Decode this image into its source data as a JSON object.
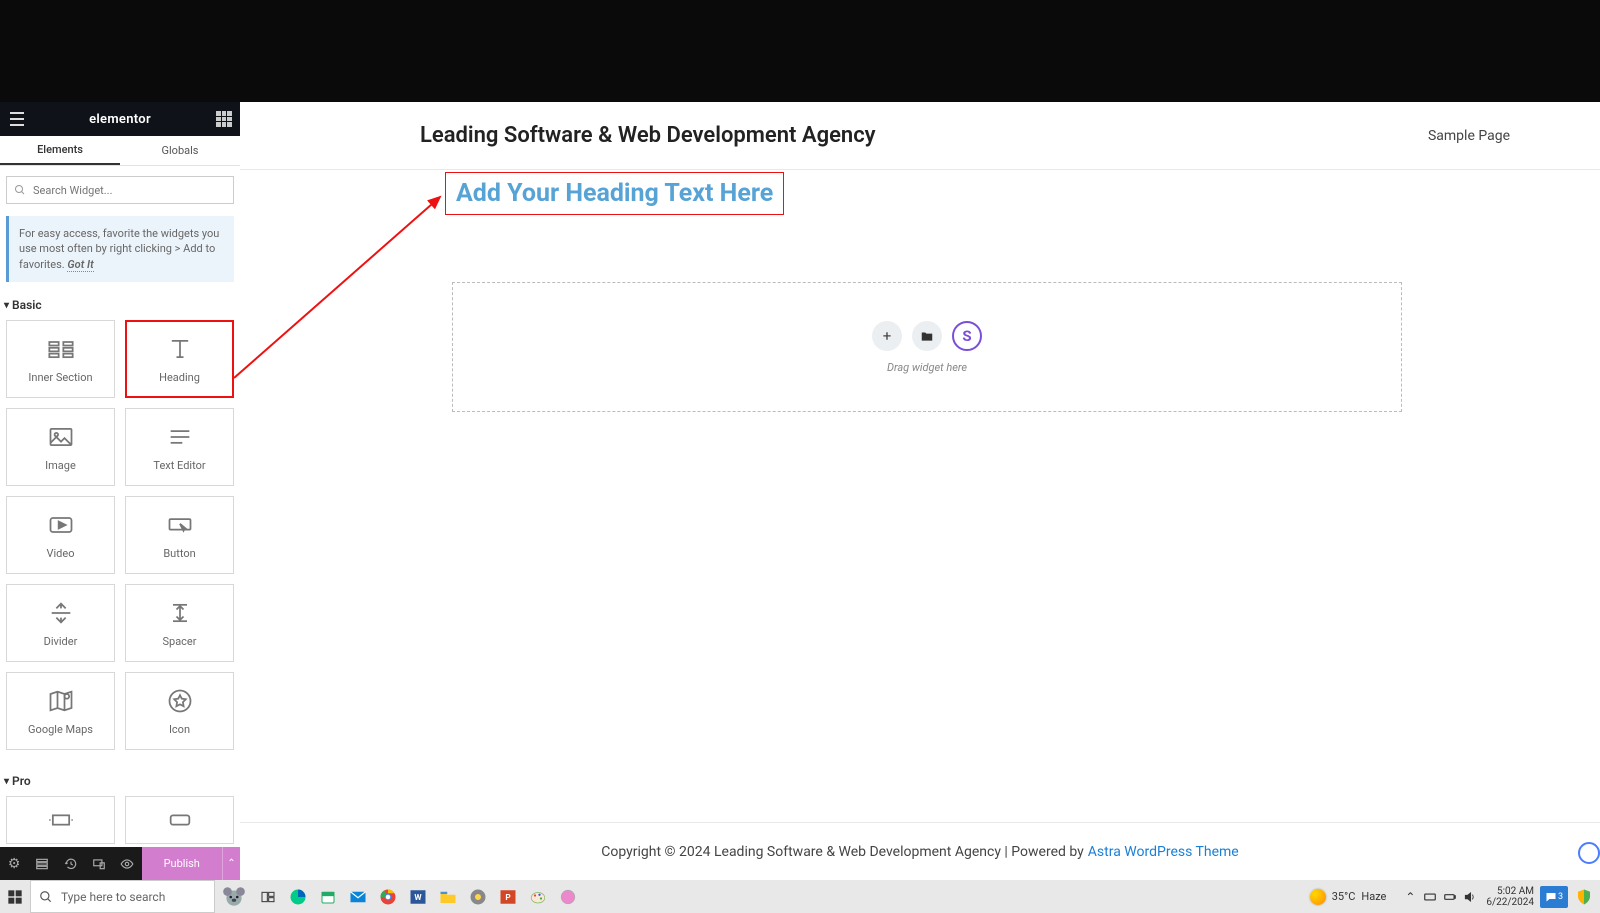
{
  "sidebar": {
    "title": "elementor",
    "tabs": {
      "elements": "Elements",
      "globals": "Globals"
    },
    "search_placeholder": "Search Widget...",
    "tip_text": "For easy access, favorite the widgets you use most often by right clicking > Add to favorites.",
    "tip_gotit": "Got It",
    "categories": {
      "basic": {
        "label": "Basic",
        "widgets": [
          {
            "id": "inner-section",
            "label": "Inner Section"
          },
          {
            "id": "heading",
            "label": "Heading",
            "highlighted": true
          },
          {
            "id": "image",
            "label": "Image"
          },
          {
            "id": "text-editor",
            "label": "Text Editor"
          },
          {
            "id": "video",
            "label": "Video"
          },
          {
            "id": "button",
            "label": "Button"
          },
          {
            "id": "divider",
            "label": "Divider"
          },
          {
            "id": "spacer",
            "label": "Spacer"
          },
          {
            "id": "google-maps",
            "label": "Google Maps"
          },
          {
            "id": "icon",
            "label": "Icon"
          }
        ]
      },
      "pro": {
        "label": "Pro"
      }
    },
    "publish_label": "Publish"
  },
  "canvas": {
    "site_title": "Leading Software & Web Development Agency",
    "nav": {
      "sample_page": "Sample Page"
    },
    "heading_widget_text": "Add Your Heading Text Here",
    "drop_hint": "Drag widget here",
    "drop_buttons": {
      "plus": "+",
      "folder": "folder",
      "s": "S"
    },
    "footer_prefix": "Copyright © 2024 Leading Software & Web Development Agency | Powered by ",
    "footer_link": "Astra WordPress Theme"
  },
  "taskbar": {
    "search_placeholder": "Type here to search",
    "weather_temp": "35°C",
    "weather_cond": "Haze",
    "time": "5:02 AM",
    "date": "6/22/2024",
    "notify_count": "3"
  }
}
